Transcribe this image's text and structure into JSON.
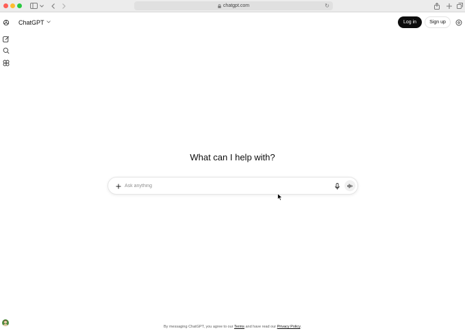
{
  "browser": {
    "url": "chatgpt.com"
  },
  "header": {
    "model_name": "ChatGPT",
    "login_label": "Log in",
    "signup_label": "Sign up"
  },
  "main": {
    "headline": "What can I help with?",
    "composer": {
      "placeholder": "Ask anything",
      "value": ""
    }
  },
  "footer": {
    "prefix": "By messaging ChatGPT, you agree to our ",
    "terms": "Terms",
    "middle": " and have read our ",
    "privacy": "Privacy Policy",
    "suffix": "."
  },
  "icons": {
    "sidebar": [
      "openai-logo-icon",
      "new-chat-icon",
      "search-icon",
      "explore-gpts-icon"
    ],
    "browser_toolbar": [
      "sidebar-toggle-icon",
      "back-icon",
      "forward-icon",
      "share-icon",
      "new-tab-icon",
      "tab-overview-icon"
    ]
  },
  "colors": {
    "login_bg": "#0d0d0d",
    "login_text": "#ffffff",
    "traffic_red": "#fe5f57",
    "traffic_yellow": "#febc2e",
    "traffic_green": "#28c840"
  }
}
